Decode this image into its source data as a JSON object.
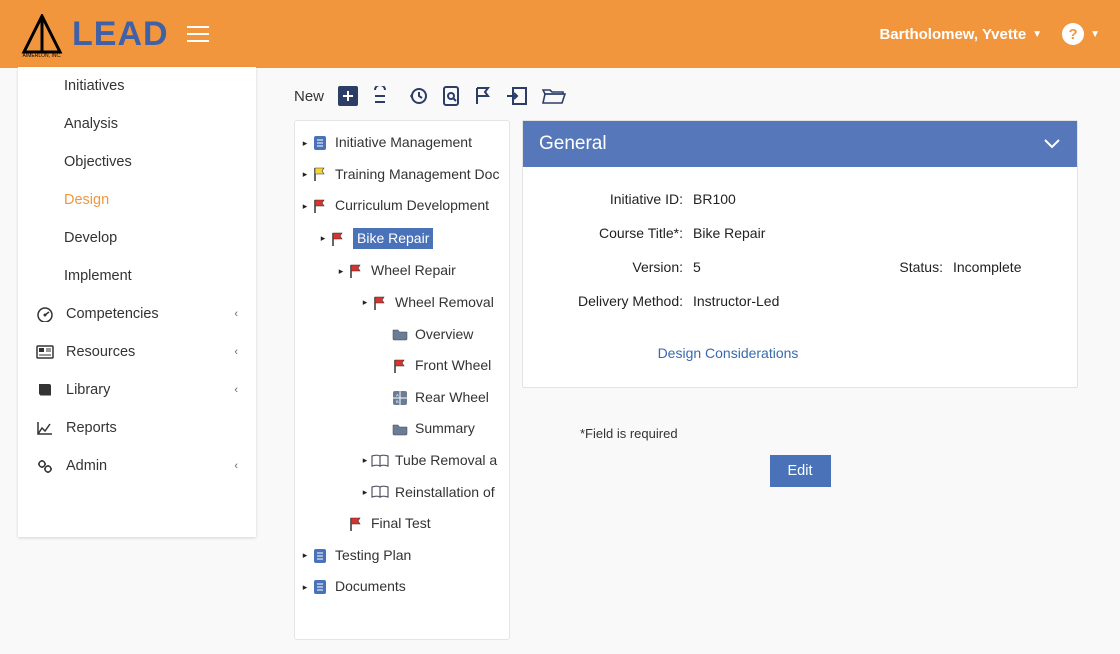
{
  "header": {
    "brand": "LEAD",
    "subbrand": "AIMERLON, INC.",
    "user": "Bartholomew, Yvette"
  },
  "sidebar": {
    "items": [
      {
        "label": "Initiatives",
        "sub": true
      },
      {
        "label": "Analysis",
        "sub": true
      },
      {
        "label": "Objectives",
        "sub": true
      },
      {
        "label": "Design",
        "sub": true,
        "active": true
      },
      {
        "label": "Develop",
        "sub": true
      },
      {
        "label": "Implement",
        "sub": true
      },
      {
        "label": "Competencies",
        "icon": "dashboard",
        "chev": true
      },
      {
        "label": "Resources",
        "icon": "card",
        "chev": true
      },
      {
        "label": "Library",
        "icon": "book",
        "chev": true
      },
      {
        "label": "Reports",
        "icon": "chart"
      },
      {
        "label": "Admin",
        "icon": "gears",
        "chev": true
      }
    ]
  },
  "toolbar": {
    "new_label": "New"
  },
  "tree": [
    {
      "label": "Initiative Management",
      "icon": "doc",
      "lv": 1,
      "tog": true
    },
    {
      "label": "Training Management Doc",
      "icon": "flag-y",
      "lv": 1,
      "tog": true
    },
    {
      "label": "Curriculum Development",
      "icon": "flag-r",
      "lv": 1,
      "tog": true
    },
    {
      "label": "Bike Repair",
      "icon": "flag-r",
      "lv": 2,
      "tog": true,
      "selected": true
    },
    {
      "label": "Wheel Repair",
      "icon": "flag-r",
      "lv": 3,
      "tog": true
    },
    {
      "label": "Wheel Removal",
      "icon": "flag-r",
      "lv": 4,
      "tog": true
    },
    {
      "label": "Overview",
      "icon": "folder",
      "lv": 5
    },
    {
      "label": "Front Wheel",
      "icon": "flag-r",
      "lv": 5
    },
    {
      "label": "Rear Wheel",
      "icon": "grid",
      "lv": 5
    },
    {
      "label": "Summary",
      "icon": "folder",
      "lv": 5
    },
    {
      "label": "Tube Removal a",
      "icon": "openbook",
      "lv": 4,
      "tog": true
    },
    {
      "label": "Reinstallation of",
      "icon": "openbook",
      "lv": 4,
      "tog": true
    },
    {
      "label": "Final Test",
      "icon": "flag-r",
      "lv": 3
    },
    {
      "label": "Testing Plan",
      "icon": "doc",
      "lv": 1,
      "tog": true
    },
    {
      "label": "Documents",
      "icon": "doc",
      "lv": 1,
      "tog": true
    }
  ],
  "panel": {
    "title": "General",
    "initiative_id_label": "Initiative ID:",
    "initiative_id": "BR100",
    "course_title_label": "Course Title*:",
    "course_title": "Bike Repair",
    "version_label": "Version:",
    "version": "5",
    "status_label": "Status:",
    "status": "Incomplete",
    "delivery_label": "Delivery Method:",
    "delivery": "Instructor-Led",
    "design_link": "Design Considerations",
    "required_note": "*Field is required",
    "edit_label": "Edit"
  }
}
